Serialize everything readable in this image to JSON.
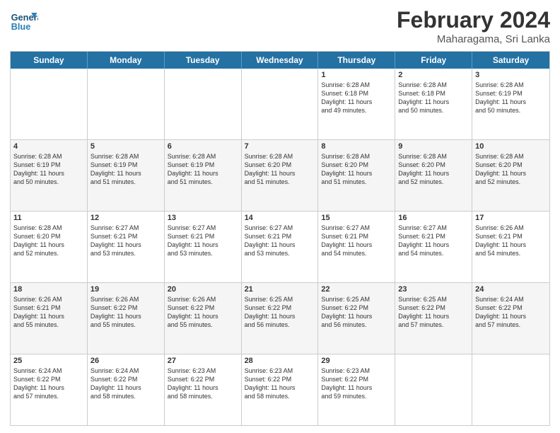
{
  "header": {
    "logo_line1": "General",
    "logo_line2": "Blue",
    "title": "February 2024",
    "subtitle": "Maharagama, Sri Lanka"
  },
  "days": [
    "Sunday",
    "Monday",
    "Tuesday",
    "Wednesday",
    "Thursday",
    "Friday",
    "Saturday"
  ],
  "rows": [
    [
      {
        "day": "",
        "info": ""
      },
      {
        "day": "",
        "info": ""
      },
      {
        "day": "",
        "info": ""
      },
      {
        "day": "",
        "info": ""
      },
      {
        "day": "1",
        "info": "Sunrise: 6:28 AM\nSunset: 6:18 PM\nDaylight: 11 hours\nand 49 minutes."
      },
      {
        "day": "2",
        "info": "Sunrise: 6:28 AM\nSunset: 6:18 PM\nDaylight: 11 hours\nand 50 minutes."
      },
      {
        "day": "3",
        "info": "Sunrise: 6:28 AM\nSunset: 6:19 PM\nDaylight: 11 hours\nand 50 minutes."
      }
    ],
    [
      {
        "day": "4",
        "info": "Sunrise: 6:28 AM\nSunset: 6:19 PM\nDaylight: 11 hours\nand 50 minutes."
      },
      {
        "day": "5",
        "info": "Sunrise: 6:28 AM\nSunset: 6:19 PM\nDaylight: 11 hours\nand 51 minutes."
      },
      {
        "day": "6",
        "info": "Sunrise: 6:28 AM\nSunset: 6:19 PM\nDaylight: 11 hours\nand 51 minutes."
      },
      {
        "day": "7",
        "info": "Sunrise: 6:28 AM\nSunset: 6:20 PM\nDaylight: 11 hours\nand 51 minutes."
      },
      {
        "day": "8",
        "info": "Sunrise: 6:28 AM\nSunset: 6:20 PM\nDaylight: 11 hours\nand 51 minutes."
      },
      {
        "day": "9",
        "info": "Sunrise: 6:28 AM\nSunset: 6:20 PM\nDaylight: 11 hours\nand 52 minutes."
      },
      {
        "day": "10",
        "info": "Sunrise: 6:28 AM\nSunset: 6:20 PM\nDaylight: 11 hours\nand 52 minutes."
      }
    ],
    [
      {
        "day": "11",
        "info": "Sunrise: 6:28 AM\nSunset: 6:20 PM\nDaylight: 11 hours\nand 52 minutes."
      },
      {
        "day": "12",
        "info": "Sunrise: 6:27 AM\nSunset: 6:21 PM\nDaylight: 11 hours\nand 53 minutes."
      },
      {
        "day": "13",
        "info": "Sunrise: 6:27 AM\nSunset: 6:21 PM\nDaylight: 11 hours\nand 53 minutes."
      },
      {
        "day": "14",
        "info": "Sunrise: 6:27 AM\nSunset: 6:21 PM\nDaylight: 11 hours\nand 53 minutes."
      },
      {
        "day": "15",
        "info": "Sunrise: 6:27 AM\nSunset: 6:21 PM\nDaylight: 11 hours\nand 54 minutes."
      },
      {
        "day": "16",
        "info": "Sunrise: 6:27 AM\nSunset: 6:21 PM\nDaylight: 11 hours\nand 54 minutes."
      },
      {
        "day": "17",
        "info": "Sunrise: 6:26 AM\nSunset: 6:21 PM\nDaylight: 11 hours\nand 54 minutes."
      }
    ],
    [
      {
        "day": "18",
        "info": "Sunrise: 6:26 AM\nSunset: 6:21 PM\nDaylight: 11 hours\nand 55 minutes."
      },
      {
        "day": "19",
        "info": "Sunrise: 6:26 AM\nSunset: 6:22 PM\nDaylight: 11 hours\nand 55 minutes."
      },
      {
        "day": "20",
        "info": "Sunrise: 6:26 AM\nSunset: 6:22 PM\nDaylight: 11 hours\nand 55 minutes."
      },
      {
        "day": "21",
        "info": "Sunrise: 6:25 AM\nSunset: 6:22 PM\nDaylight: 11 hours\nand 56 minutes."
      },
      {
        "day": "22",
        "info": "Sunrise: 6:25 AM\nSunset: 6:22 PM\nDaylight: 11 hours\nand 56 minutes."
      },
      {
        "day": "23",
        "info": "Sunrise: 6:25 AM\nSunset: 6:22 PM\nDaylight: 11 hours\nand 57 minutes."
      },
      {
        "day": "24",
        "info": "Sunrise: 6:24 AM\nSunset: 6:22 PM\nDaylight: 11 hours\nand 57 minutes."
      }
    ],
    [
      {
        "day": "25",
        "info": "Sunrise: 6:24 AM\nSunset: 6:22 PM\nDaylight: 11 hours\nand 57 minutes."
      },
      {
        "day": "26",
        "info": "Sunrise: 6:24 AM\nSunset: 6:22 PM\nDaylight: 11 hours\nand 58 minutes."
      },
      {
        "day": "27",
        "info": "Sunrise: 6:23 AM\nSunset: 6:22 PM\nDaylight: 11 hours\nand 58 minutes."
      },
      {
        "day": "28",
        "info": "Sunrise: 6:23 AM\nSunset: 6:22 PM\nDaylight: 11 hours\nand 58 minutes."
      },
      {
        "day": "29",
        "info": "Sunrise: 6:23 AM\nSunset: 6:22 PM\nDaylight: 11 hours\nand 59 minutes."
      },
      {
        "day": "",
        "info": ""
      },
      {
        "day": "",
        "info": ""
      }
    ]
  ]
}
